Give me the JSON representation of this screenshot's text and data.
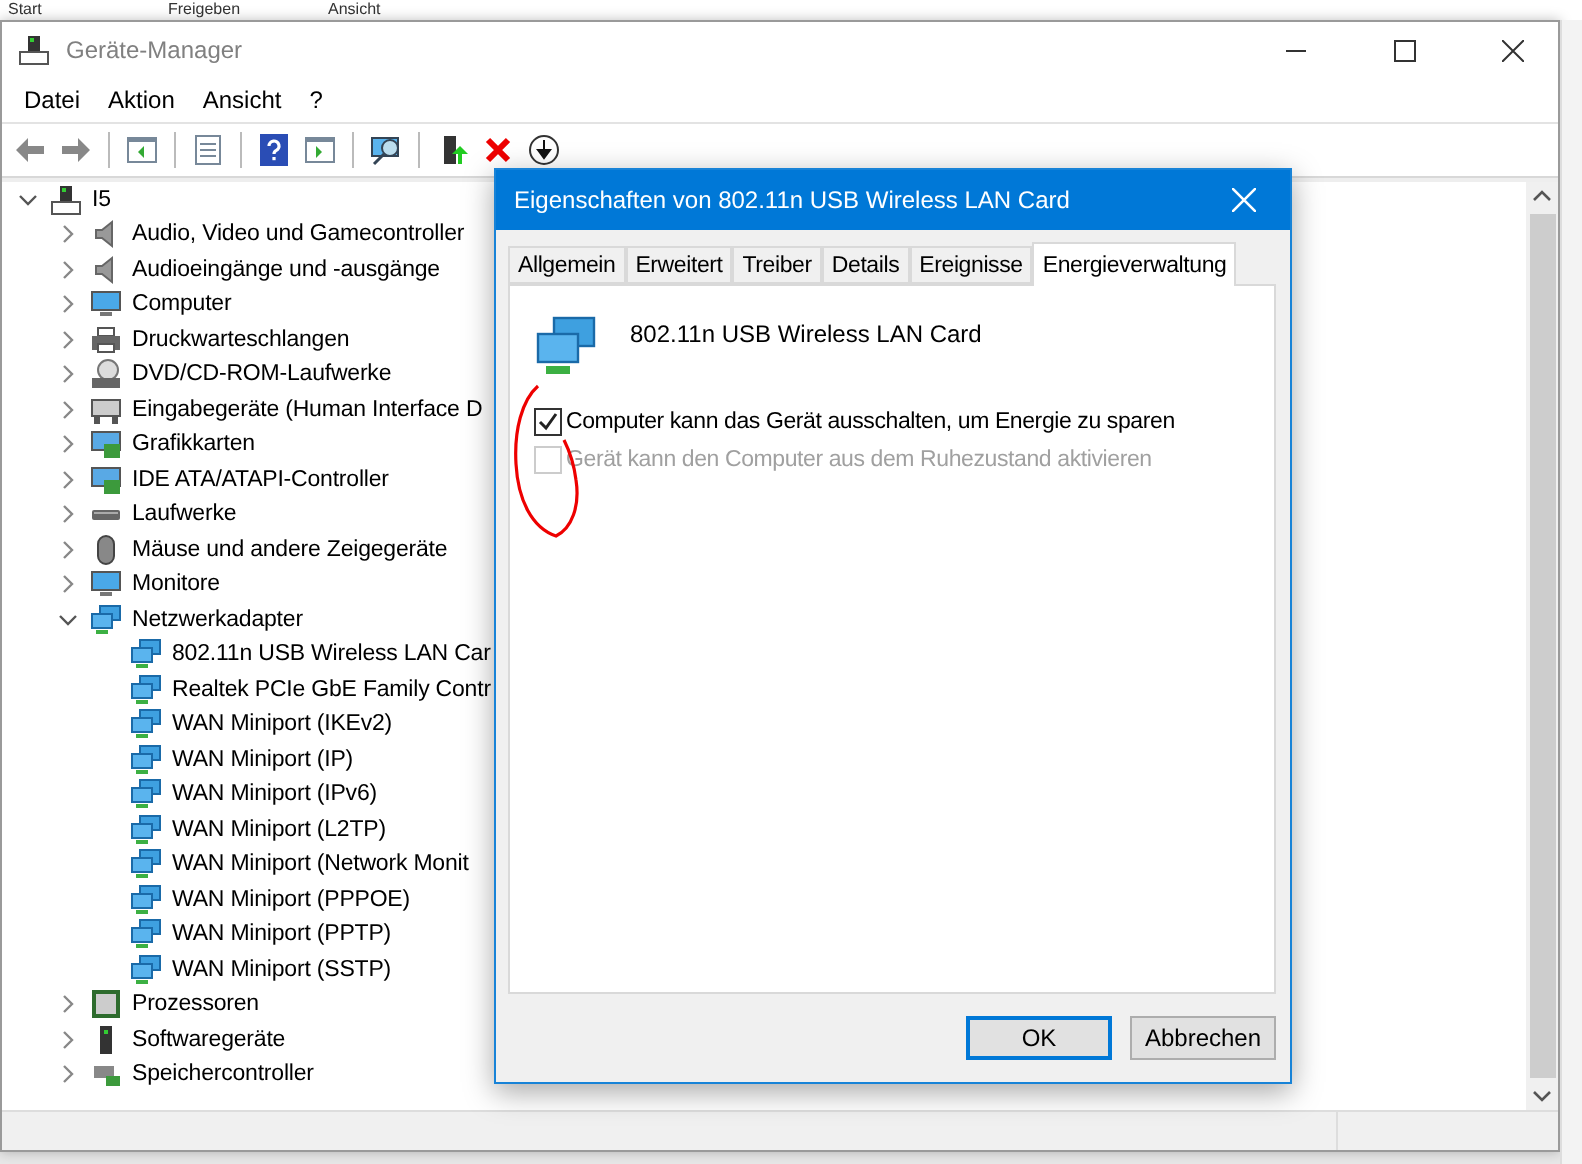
{
  "background_tabs": [
    "Start",
    "Freigeben",
    "Ansicht"
  ],
  "window": {
    "title": "Geräte-Manager"
  },
  "menu": [
    "Datei",
    "Aktion",
    "Ansicht",
    "?"
  ],
  "toolbar": [
    {
      "kind": "back"
    },
    {
      "kind": "forward"
    },
    {
      "kind": "sep"
    },
    {
      "kind": "tree"
    },
    {
      "kind": "sep"
    },
    {
      "kind": "props"
    },
    {
      "kind": "sep"
    },
    {
      "kind": "help"
    },
    {
      "kind": "pane"
    },
    {
      "kind": "sep"
    },
    {
      "kind": "scan"
    },
    {
      "kind": "sep"
    },
    {
      "kind": "update"
    },
    {
      "kind": "remove"
    },
    {
      "kind": "download"
    }
  ],
  "tree": {
    "label": "I5",
    "expanded": true,
    "children": [
      {
        "label": "Audio, Video und Gamecontroller",
        "kind": "speaker",
        "expanded": false
      },
      {
        "label": "Audioeingänge und -ausgänge",
        "kind": "speaker",
        "expanded": false
      },
      {
        "label": "Computer",
        "kind": "monitor",
        "expanded": false
      },
      {
        "label": "Druckwarteschlangen",
        "kind": "printer",
        "expanded": false
      },
      {
        "label": "DVD/CD-ROM-Laufwerke",
        "kind": "disc",
        "expanded": false
      },
      {
        "label": "Eingabegeräte (Human Interface D",
        "kind": "keyboard",
        "expanded": false
      },
      {
        "label": "Grafikkarten",
        "kind": "card",
        "expanded": false
      },
      {
        "label": "IDE ATA/ATAPI-Controller",
        "kind": "card",
        "expanded": false
      },
      {
        "label": "Laufwerke",
        "kind": "drive",
        "expanded": false
      },
      {
        "label": "Mäuse und andere Zeigegeräte",
        "kind": "mouse",
        "expanded": false
      },
      {
        "label": "Monitore",
        "kind": "monitor",
        "expanded": false
      },
      {
        "label": "Netzwerkadapter",
        "kind": "network",
        "expanded": true,
        "children": [
          {
            "label": "802.11n USB Wireless LAN Car"
          },
          {
            "label": "Realtek PCIe GbE Family Contr"
          },
          {
            "label": "WAN Miniport (IKEv2)"
          },
          {
            "label": "WAN Miniport (IP)"
          },
          {
            "label": "WAN Miniport (IPv6)"
          },
          {
            "label": "WAN Miniport (L2TP)"
          },
          {
            "label": "WAN Miniport (Network Monit"
          },
          {
            "label": "WAN Miniport (PPPOE)"
          },
          {
            "label": "WAN Miniport (PPTP)"
          },
          {
            "label": "WAN Miniport (SSTP)"
          }
        ]
      },
      {
        "label": "Prozessoren",
        "kind": "chip",
        "expanded": false
      },
      {
        "label": "Softwaregeräte",
        "kind": "device",
        "expanded": false
      },
      {
        "label": "Speichercontroller",
        "kind": "storage",
        "expanded": false
      }
    ]
  },
  "dialog": {
    "title": "Eigenschaften von 802.11n USB Wireless LAN Card",
    "tabs": [
      {
        "label": "Allgemein",
        "selected": false
      },
      {
        "label": "Erweitert",
        "selected": false
      },
      {
        "label": "Treiber",
        "selected": false
      },
      {
        "label": "Details",
        "selected": false
      },
      {
        "label": "Ereignisse",
        "selected": false
      },
      {
        "label": "Energieverwaltung",
        "selected": true
      }
    ],
    "device_name": "802.11n USB Wireless LAN Card",
    "options": [
      {
        "label": "Computer kann das Gerät ausschalten, um Energie zu sparen",
        "checked": true,
        "disabled": false
      },
      {
        "label": "Gerät kann den Computer aus dem Ruhezustand aktivieren",
        "checked": false,
        "disabled": true
      }
    ],
    "buttons": [
      {
        "label": "OK",
        "default": true
      },
      {
        "label": "Abbrechen",
        "default": false
      }
    ]
  }
}
